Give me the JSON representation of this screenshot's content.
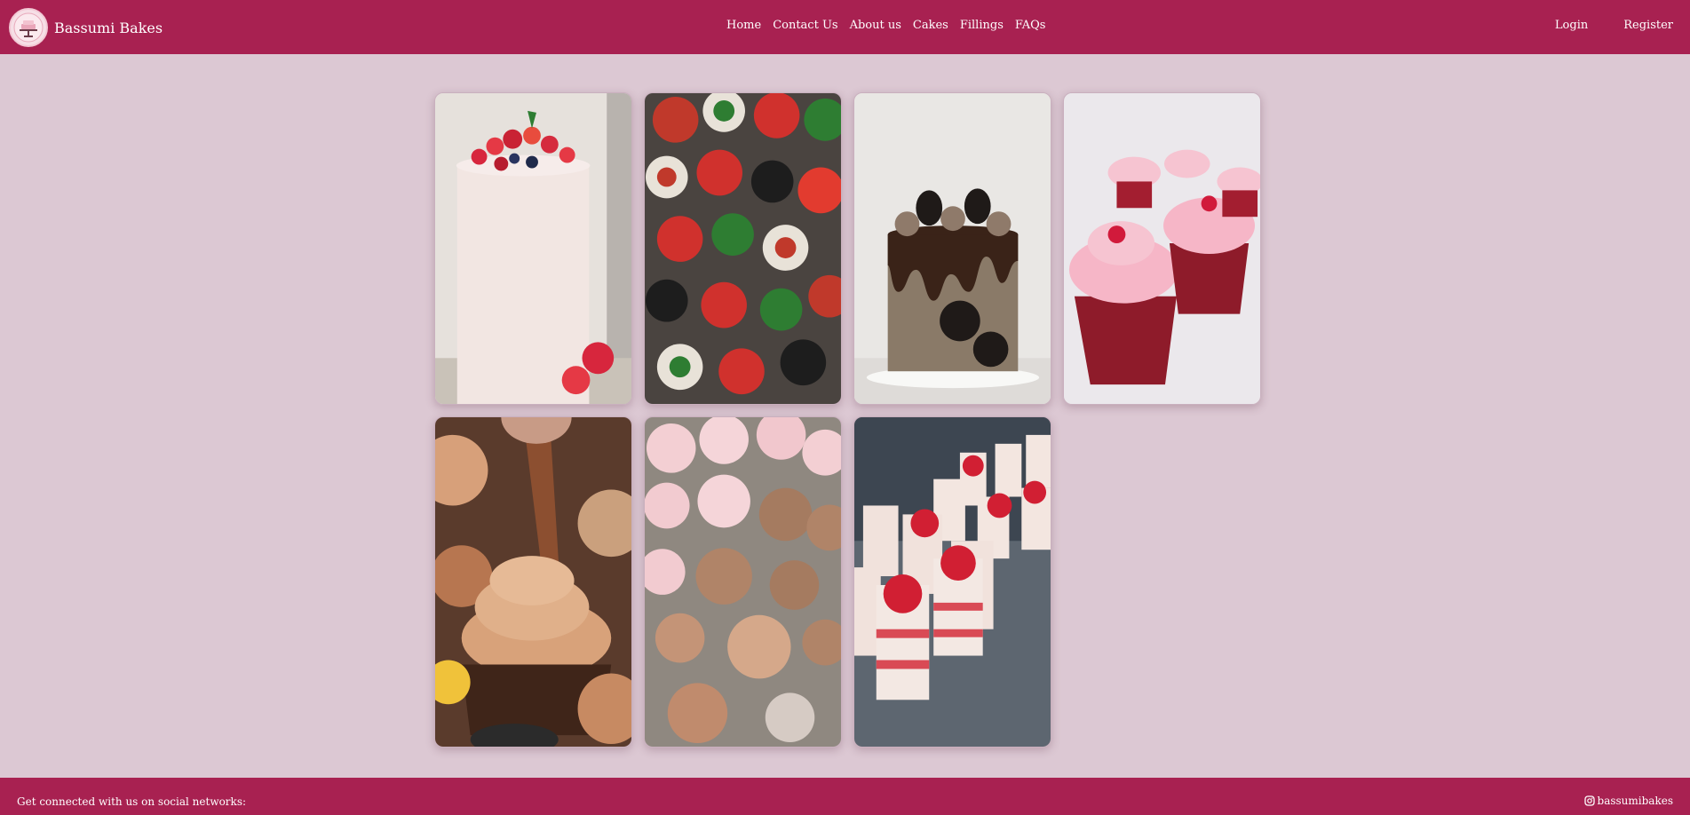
{
  "header": {
    "brand_name": "Bassumi Bakes",
    "nav_links": [
      "Home",
      "Contact Us",
      "About us",
      "Cakes",
      "Fillings",
      "FAQs"
    ],
    "auth_links": [
      "Login",
      "Register"
    ]
  },
  "gallery": {
    "items": [
      "cake-strawberry-cream",
      "cupcakes-red-green-rosettes",
      "cake-oreo-chocolate-drip",
      "cupcakes-red-velvet-pink-frosting",
      "cupcakes-piping-chocolate-frosting",
      "cupcakes-chocolate-and-pink",
      "strawberry-shortcake-cups"
    ]
  },
  "footer": {
    "text": "Get connected with us on social networks:",
    "social_handle": "bassumibakes",
    "social_icon": "instagram-icon"
  },
  "colors": {
    "primary": "#a82151",
    "background": "#dcc8d3"
  }
}
